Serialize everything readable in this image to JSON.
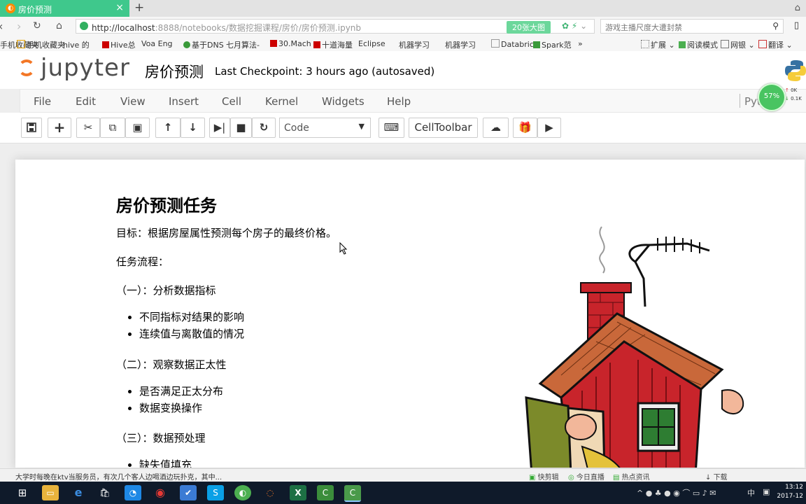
{
  "browser": {
    "tab_title": "房价预测",
    "tab_favicon": "jupyter-icon",
    "url_host": "http://localhost",
    "url_rest": ":8888/notebooks/数据挖掘课程/房价/房价预测.ipynb",
    "badge": "20张大图",
    "search_placeholder": "游戏主播尺度大遭封禁"
  },
  "bookmarks": [
    "手机收藏夹",
    "hive 的",
    "Hive总",
    "Voa Eng",
    "基于DNS",
    "七月算法-",
    "30.Mach",
    "十道海量",
    "Eclipse",
    "机器学习",
    "机器学习",
    "Databric",
    "Spark范",
    "»",
    "扩展",
    "阅读模式",
    "网银",
    "翻译"
  ],
  "jupyter": {
    "logo_text": "jupyter",
    "notebook_name": "房价预测",
    "checkpoint": "Last Checkpoint: 3 hours ago (autosaved)",
    "kernel_name": "Pyt",
    "net_percent": "57%",
    "net_up": "0K",
    "net_down": "0.1K"
  },
  "menu": [
    "File",
    "Edit",
    "View",
    "Insert",
    "Cell",
    "Kernel",
    "Widgets",
    "Help"
  ],
  "toolbar": {
    "cell_type": "Code",
    "celltoolbar_label": "CellToolbar"
  },
  "notebook": {
    "heading": "房价预测任务",
    "goal": "目标：根据房屋属性预测每个房子的最终价格。",
    "process_label": "任务流程：",
    "step1": "（一）：分析数据指标",
    "step1_items": [
      "不同指标对结果的影响",
      "连续值与离散值的情况"
    ],
    "step2": "（二）：观察数据正太性",
    "step2_items": [
      "是否满足正太分布",
      "数据变换操作"
    ],
    "step3": "（三）：数据预处理",
    "step3_items": [
      "缺失值填充"
    ]
  },
  "statusbar": {
    "news": "大学时每晚在ktv当服务员，有次几个客人边喝酒边玩扑克，其中...",
    "items": [
      "快剪辑",
      "今日直播",
      "热点资讯",
      "下载"
    ]
  },
  "taskbar": {
    "ime": "中",
    "time": "13:12",
    "date": "2017-12"
  },
  "colors": {
    "tab_green": "#3fc88c",
    "jupyter_orange": "#f37726",
    "house_red": "#c8242b"
  }
}
